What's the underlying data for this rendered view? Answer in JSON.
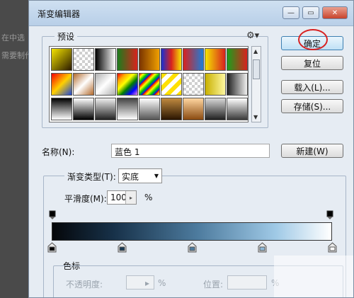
{
  "background": {
    "line1": "在中选",
    "line2": "需要制作"
  },
  "window": {
    "title": "渐变编辑器",
    "controls": {
      "minimize": "—",
      "maximize": "▭",
      "close": "✕"
    }
  },
  "presets": {
    "label": "预设",
    "swatch_rows": [
      [
        "linear-gradient(135deg,#f5e400,#2a1a00)",
        "repeating-conic-gradient(#cfcfcf 0% 25%, #fff 0% 50%) 0 0/8px 8px",
        "linear-gradient(90deg,#000,#fff)",
        "linear-gradient(90deg,#1b7c1b,#d8221e)",
        "linear-gradient(90deg,#7a3400,#f0a000)",
        "linear-gradient(90deg,#1530d4,#d8221e,#f5e400)",
        "linear-gradient(90deg,#d8221e,#1e7dd8)",
        "linear-gradient(90deg,#f5e400,#d8221e)",
        "linear-gradient(90deg,#1b9e1b,#d8221e)"
      ],
      [
        "linear-gradient(135deg,#f50000,#ffd000,#1d46d8)",
        "linear-gradient(135deg,#b36a2c,#fff,#b36a2c)",
        "linear-gradient(135deg,#b0b0b0,#fff,#b0b0b0)",
        "linear-gradient(135deg,red,orange,yellow,green,blue,violet)",
        "repeating-linear-gradient(135deg,#e00,#ff0 4px,#0c0 8px,#00f 12px)",
        "repeating-linear-gradient(135deg,#ffe000 0 6px,#fff 6px 12px)",
        "repeating-conic-gradient(#cfcfcf 0% 25%, #fff 0% 50%) 0 0/8px 8px",
        "linear-gradient(90deg,#c8b000,#fff8a0)",
        "linear-gradient(90deg,#202020,#f0f0f0)"
      ],
      [
        "linear-gradient(180deg,#000,#fff)",
        "linear-gradient(180deg,#fff,#000)",
        "linear-gradient(180deg,#eee,#222)",
        "linear-gradient(180deg,#444,#fff)",
        "linear-gradient(180deg,#fff,#555)",
        "linear-gradient(180deg,#c08a40,#2a1400)",
        "linear-gradient(180deg,#ffd6a0,#8a4a10)",
        "linear-gradient(180deg,#d8d8d8,#202020)",
        "linear-gradient(180deg,#fff,#3a3a3a)"
      ]
    ],
    "scroll_up": "▲",
    "scroll_down": "▼"
  },
  "buttons": {
    "ok": "确定",
    "reset": "复位",
    "load": "载入(L)...",
    "save": "存储(S)...",
    "new": "新建(W)"
  },
  "name": {
    "label": "名称(N):",
    "value": "蓝色 1"
  },
  "gradient": {
    "type_label": "渐变类型(T):",
    "type_value": "实底",
    "smoothness_label": "平滑度(M):",
    "smoothness_value": "100",
    "percent": "%",
    "stops": {
      "color_stops_at": [
        0,
        25,
        50,
        75,
        100
      ]
    }
  },
  "color_stops_section": {
    "label": "色标",
    "opacity_label": "不透明度:",
    "opacity_unit": "%",
    "location_label": "位置:",
    "location_unit": "%"
  }
}
